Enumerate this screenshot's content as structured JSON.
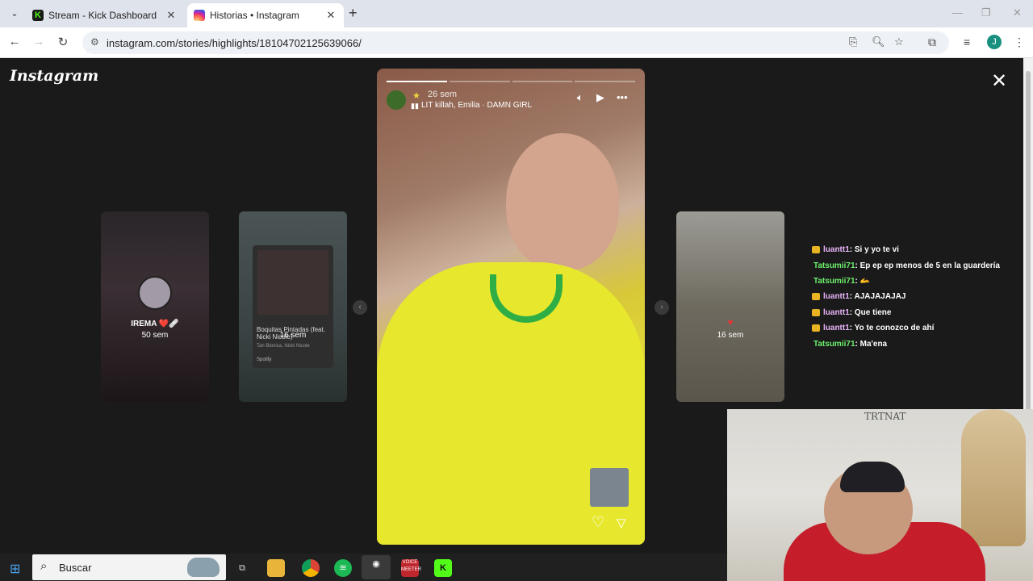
{
  "browser": {
    "tabs": [
      {
        "title": "Stream - Kick Dashboard",
        "close": "✕"
      },
      {
        "title": "Historias • Instagram",
        "close": "✕"
      }
    ],
    "new_tab": "+",
    "url": "instagram.com/stories/highlights/18104702125639066/",
    "profile_initial": "J"
  },
  "instagram": {
    "logo": "Instagram",
    "close": "✕",
    "side_stories": [
      {
        "user": "IREMA ❤️🩹",
        "time": "50 sem"
      },
      {
        "user": "",
        "time": "16 sem",
        "music": {
          "title": "Boquitas Pintadas (feat. Nicki Nicole)",
          "artist": "Tan Bionica, Nicki Nicole",
          "service": "Spotify"
        }
      },
      {
        "user": "",
        "time": "16 sem"
      }
    ],
    "main_story": {
      "time": "26 sem",
      "song": "LIT killah, Emilia · DAMN GIRL"
    },
    "prev_arrow": "‹",
    "next_arrow": "›"
  },
  "chat": [
    {
      "user": "luantt1",
      "msg": " : Si y yo te vi",
      "badge": true
    },
    {
      "user": "Tatsumii71",
      "msg": " : Ep ep ep menos de 5 en la guardería",
      "badge": false
    },
    {
      "user": "Tatsumii71",
      "msg": " : 🫴",
      "badge": false
    },
    {
      "user": "luantt1",
      "msg": " : AJAJAJAJAJ",
      "badge": true
    },
    {
      "user": "luantt1",
      "msg": " : Que tiene",
      "badge": true
    },
    {
      "user": "luantt1",
      "msg": " : Yo te conozco de ahí",
      "badge": true
    },
    {
      "user": "Tatsumii71",
      "msg": " : Ma'ena",
      "badge": false
    }
  ],
  "webcam": {
    "wall_text": "TRTNAT"
  },
  "taskbar": {
    "search_placeholder": "Buscar",
    "voicemeeter": "VOICE MEETER"
  }
}
